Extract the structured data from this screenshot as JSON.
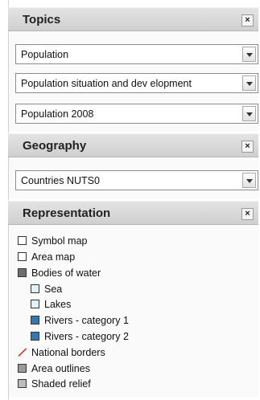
{
  "topics": {
    "title": "Topics",
    "close": "×",
    "selects": [
      {
        "value": "Population"
      },
      {
        "value": "Population situation and dev elopment"
      },
      {
        "value": "Population 2008"
      }
    ]
  },
  "geography": {
    "title": "Geography",
    "close": "×",
    "selects": [
      {
        "value": "Countries NUTS0"
      }
    ]
  },
  "representation": {
    "title": "Representation",
    "close": "×",
    "items": [
      {
        "label": "Symbol map",
        "color": "#ffffff",
        "icon": "empty-square-icon"
      },
      {
        "label": "Area map",
        "color": "#ffffff",
        "icon": "empty-square-icon"
      },
      {
        "label": "Bodies of water",
        "color": "#6e6e6e",
        "icon": "gray-square-icon"
      },
      {
        "label": "Sea",
        "color": "#dff1fb",
        "icon": "light-blue-square-icon"
      },
      {
        "label": "Lakes",
        "color": "#dff1fb",
        "icon": "light-blue-square-icon"
      },
      {
        "label": "Rivers - category 1",
        "color": "#2f79b8",
        "icon": "blue-square-icon"
      },
      {
        "label": "Rivers - category 2",
        "color": "#2f79b8",
        "icon": "blue-square-icon"
      },
      {
        "label": "National borders",
        "color": "#e23030",
        "icon": "red-slash-icon"
      },
      {
        "label": "Area outlines",
        "color": "#9a9a9a",
        "icon": "gray-square-icon"
      },
      {
        "label": "Shaded relief",
        "color": "#bdbdbd",
        "icon": "gray-square-icon"
      }
    ]
  }
}
